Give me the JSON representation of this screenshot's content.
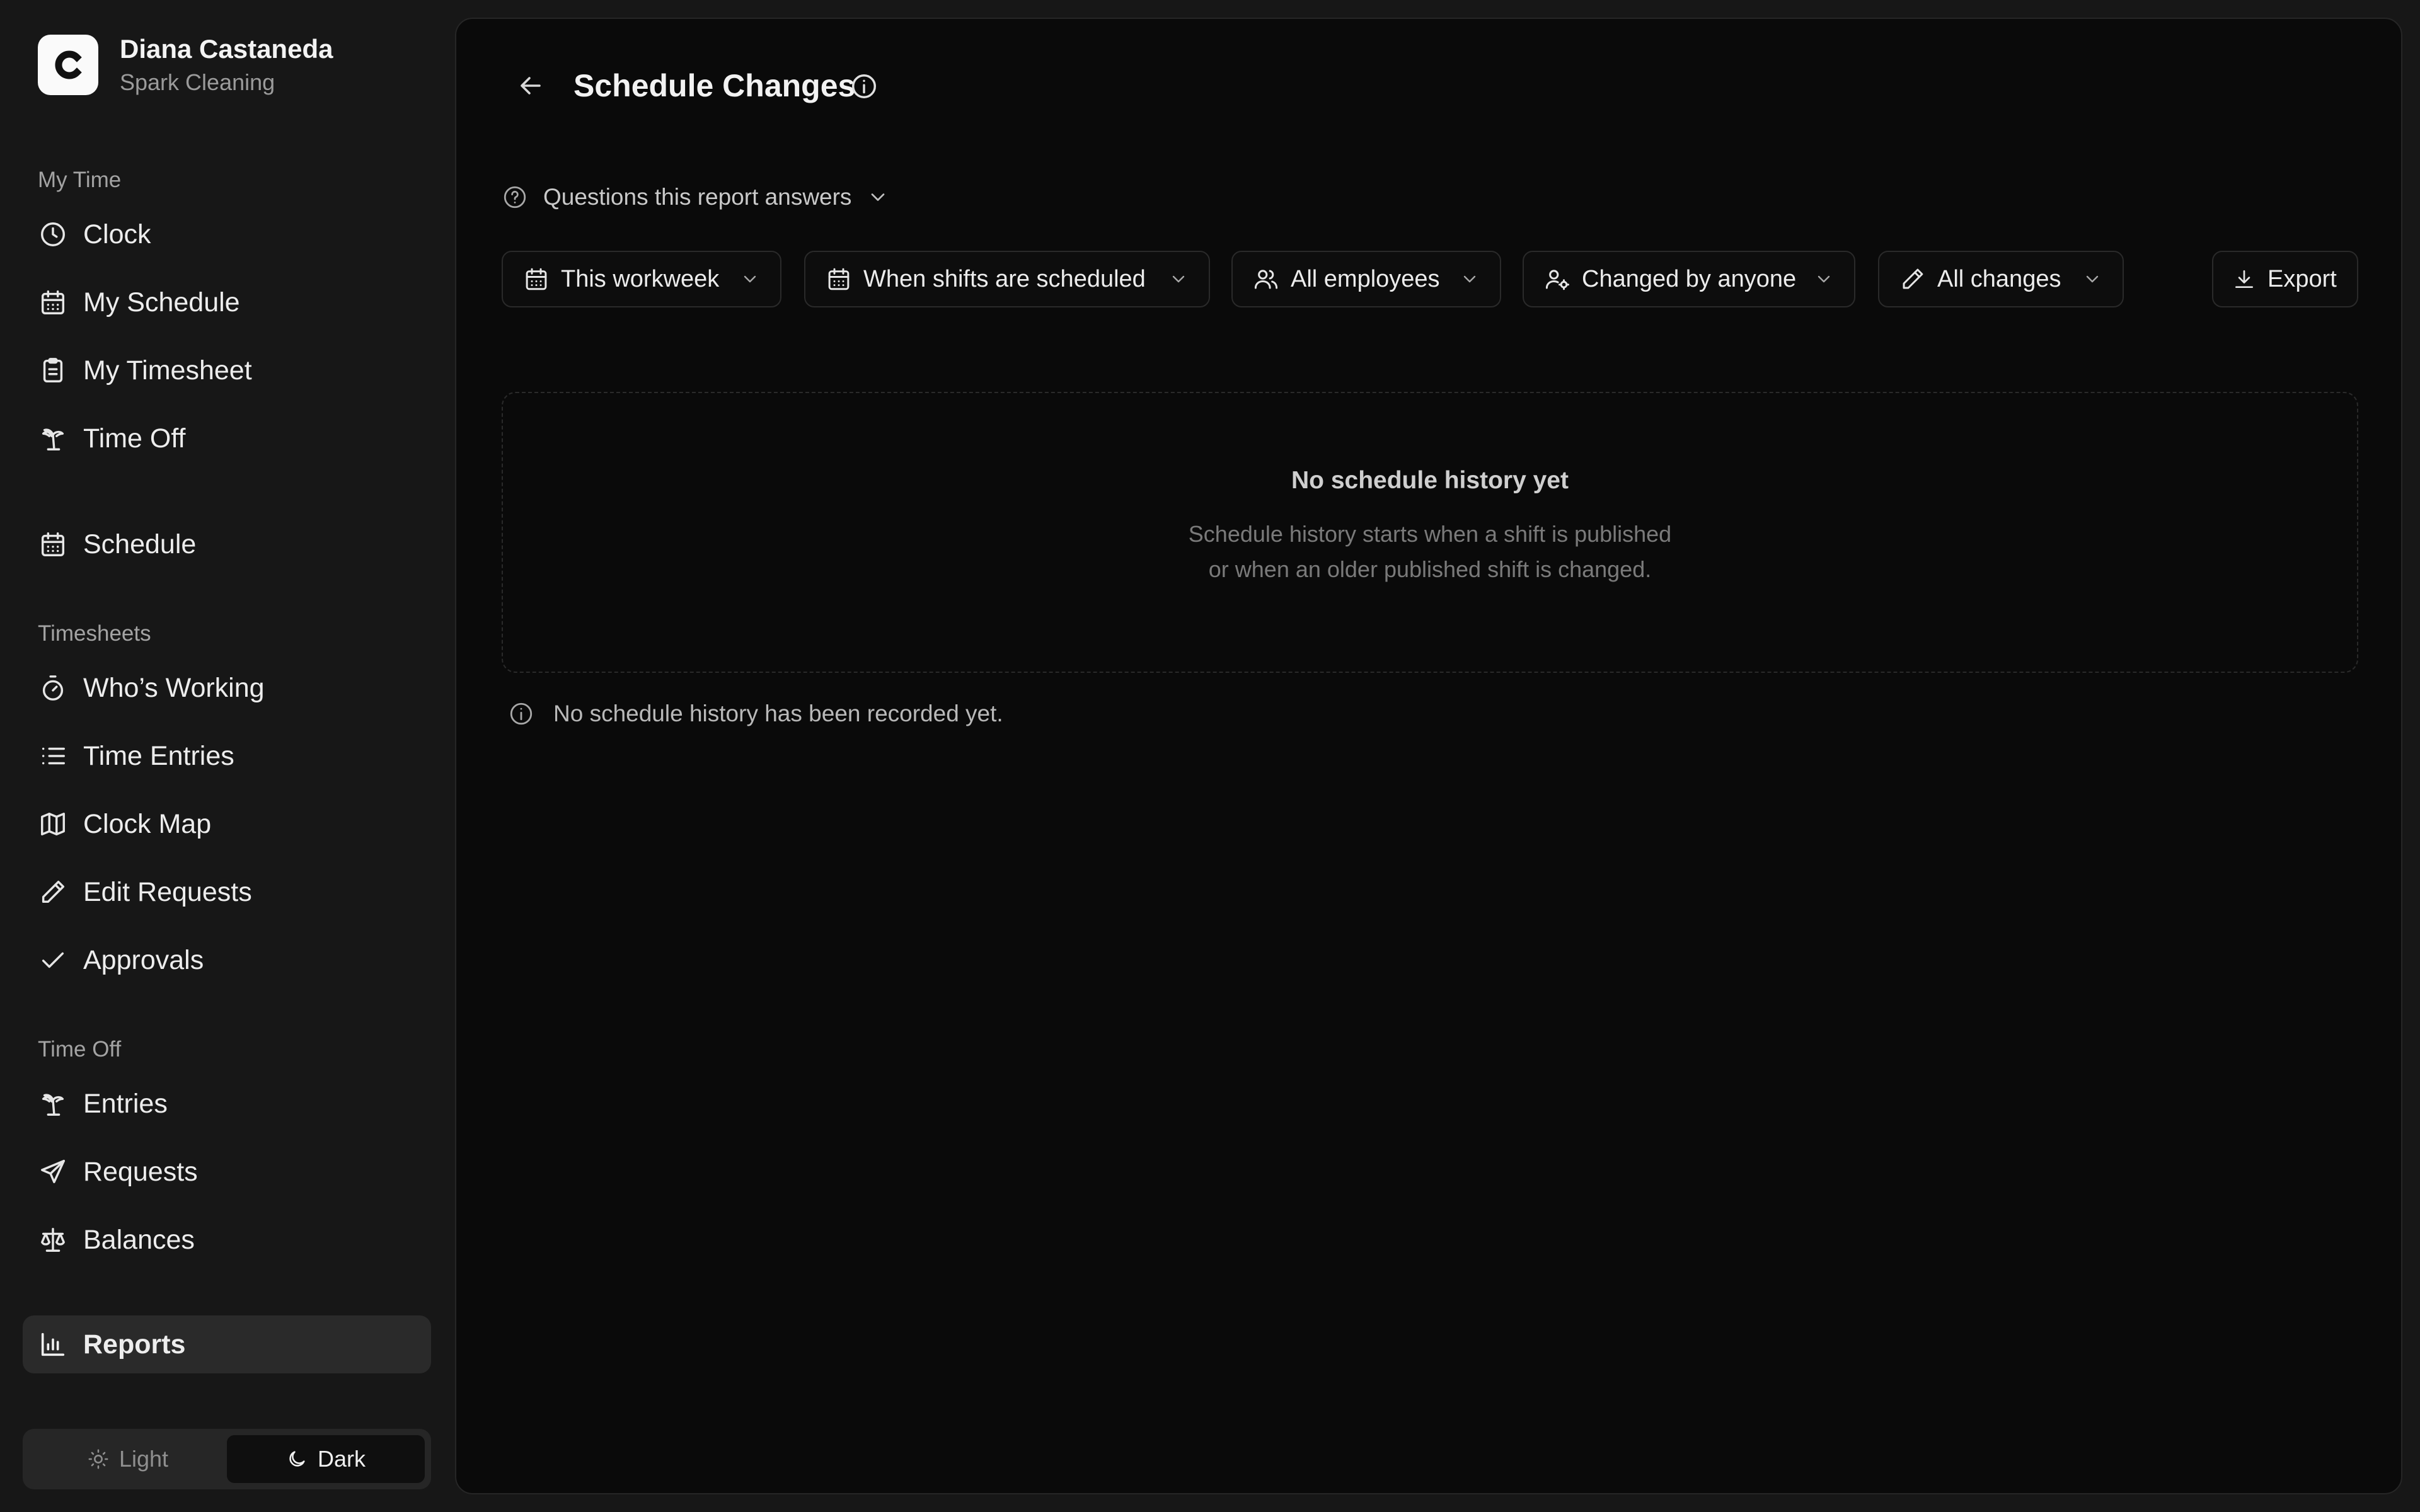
{
  "user": {
    "name": "Diana Castaneda",
    "org": "Spark Cleaning",
    "logo_letter": "C"
  },
  "sidebar": {
    "sections": {
      "my_time": "My Time",
      "timesheets": "Timesheets",
      "time_off": "Time Off"
    },
    "items": {
      "clock": "Clock",
      "my_schedule": "My Schedule",
      "my_timesheet": "My Timesheet",
      "time_off": "Time Off",
      "schedule": "Schedule",
      "whos_working": "Who’s Working",
      "time_entries": "Time Entries",
      "clock_map": "Clock Map",
      "edit_requests": "Edit Requests",
      "approvals": "Approvals",
      "entries": "Entries",
      "requests": "Requests",
      "balances": "Balances",
      "reports": "Reports"
    },
    "active": "reports",
    "theme": {
      "light": "Light",
      "dark": "Dark",
      "selected": "dark"
    }
  },
  "main": {
    "title": "Schedule Changes",
    "questions_label": "Questions this report answers",
    "filters": {
      "period": "This workweek",
      "date_basis": "When shifts are scheduled",
      "employees": "All employees",
      "changed_by": "Changed by anyone",
      "change_type": "All changes"
    },
    "export_label": "Export",
    "empty": {
      "title": "No schedule history yet",
      "desc_line1": "Schedule history starts when a shift is published",
      "desc_line2": "or when an older published shift is changed."
    },
    "note": "No schedule history has been recorded yet."
  },
  "colors": {
    "sidebar_bg": "#171717",
    "main_bg": "#0a0a0a",
    "active_item_bg": "#2a2a2a",
    "border": "#2a2a2a"
  }
}
